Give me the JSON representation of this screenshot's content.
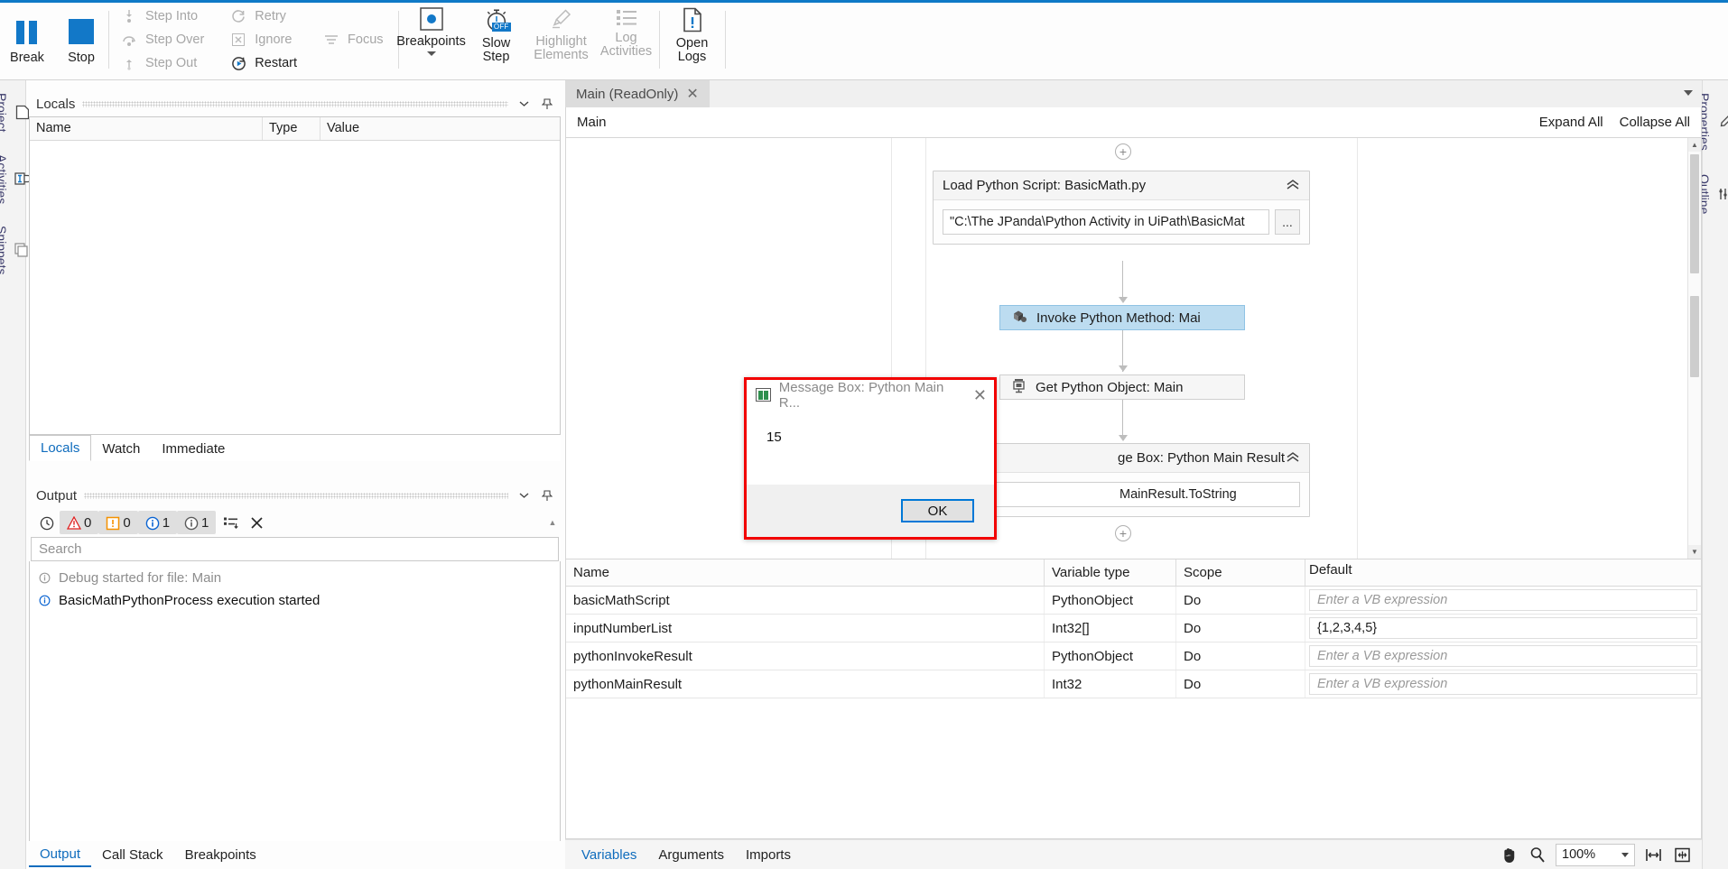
{
  "ribbon": {
    "break": {
      "label": "Break",
      "icon": "pause-icon"
    },
    "stop": {
      "label": "Stop",
      "icon": "stop-icon"
    },
    "step_into": {
      "label": "Step Into",
      "icon": "step-into-icon"
    },
    "step_over": {
      "label": "Step Over",
      "icon": "step-over-icon"
    },
    "step_out": {
      "label": "Step Out",
      "icon": "step-out-icon"
    },
    "retry": {
      "label": "Retry",
      "icon": "retry-icon"
    },
    "ignore": {
      "label": "Ignore",
      "icon": "ignore-icon"
    },
    "restart": {
      "label": "Restart",
      "icon": "restart-icon"
    },
    "focus": {
      "label": "Focus",
      "icon": "focus-icon"
    },
    "breakpoints": {
      "label": "Breakpoints",
      "icon": "breakpoint-dot-icon"
    },
    "slow_step": {
      "label_line1": "Slow",
      "label_line2": "Step",
      "icon": "stopwatch-off-icon",
      "badge": "OFF"
    },
    "highlight_elements": {
      "label_line1": "Highlight",
      "label_line2": "Elements",
      "icon": "highlighter-icon"
    },
    "log_activities": {
      "label_line1": "Log",
      "label_line2": "Activities",
      "icon": "list-icon"
    },
    "open_logs": {
      "label_line1": "Open",
      "label_line2": "Logs",
      "icon": "document-alert-icon"
    }
  },
  "left_rail": {
    "items": [
      {
        "label": "Project",
        "icon": "project-icon"
      },
      {
        "label": "Activities",
        "icon": "activities-icon"
      },
      {
        "label": "Snippets",
        "icon": "snippets-icon"
      }
    ]
  },
  "right_rail": {
    "items": [
      {
        "label": "Properties",
        "icon": "properties-icon"
      },
      {
        "label": "Outline",
        "icon": "outline-icon"
      }
    ]
  },
  "locals_panel": {
    "title": "Locals",
    "collapse_icon": "chevron-down-icon",
    "pin_icon": "pin-icon",
    "columns": [
      "Name",
      "Type",
      "Value"
    ],
    "rows": [],
    "tabs": [
      {
        "label": "Locals",
        "active": true
      },
      {
        "label": "Watch",
        "active": false
      },
      {
        "label": "Immediate",
        "active": false
      }
    ]
  },
  "output_panel": {
    "title": "Output",
    "collapse_icon": "chevron-down-icon",
    "pin_icon": "pin-icon",
    "toolbar": [
      {
        "name": "show-timestamps",
        "icon": "clock-icon",
        "count": ""
      },
      {
        "name": "errors-filter",
        "icon": "error-triangle-icon",
        "count": "0"
      },
      {
        "name": "warnings-filter",
        "icon": "warning-square-icon",
        "count": "0"
      },
      {
        "name": "info-filter",
        "icon": "info-circle-icon",
        "count": "1"
      },
      {
        "name": "trace-filter",
        "icon": "trace-circle-icon",
        "count": "1"
      },
      {
        "name": "export-logs",
        "icon": "export-list-icon",
        "count": ""
      },
      {
        "name": "clear-output",
        "icon": "close-x-icon",
        "count": ""
      }
    ],
    "search_placeholder": "Search",
    "messages": [
      {
        "icon": "info-circle-icon",
        "text": "Debug started for file: Main",
        "muted": true
      },
      {
        "icon": "info-circle-icon",
        "text": "BasicMathPythonProcess execution started",
        "muted": false
      }
    ],
    "tabs": [
      {
        "label": "Output",
        "active": true
      },
      {
        "label": "Call Stack",
        "active": false
      },
      {
        "label": "Breakpoints",
        "active": false
      }
    ]
  },
  "designer": {
    "document_tab": {
      "label": "Main (ReadOnly)",
      "close_icon": "close-icon"
    },
    "tabbar_overflow_icon": "chevron-down-icon",
    "breadcrumb": "Main",
    "expand_all": "Expand All",
    "collapse_all": "Collapse All",
    "nodes": {
      "top_plus": "+",
      "load_script": {
        "title": "Load Python Script: BasicMath.py",
        "collapse_icon": "chevron-up-icon",
        "path_value": "\"C:\\The JPanda\\Python Activity in UiPath\\BasicMat",
        "browse_label": "..."
      },
      "invoke_method": {
        "title": "Invoke Python Method: Mai",
        "icon": "invoke-python-icon",
        "selected": true
      },
      "get_object": {
        "title": "Get Python Object: Main",
        "icon": "get-python-object-icon"
      },
      "message_box_activity": {
        "title": "ge Box: Python Main Result",
        "full_title": "Message Box: Python Main Result",
        "collapse_icon": "chevron-up-icon",
        "expression": "MainResult.ToString"
      },
      "bottom_plus": "+",
      "lower_plus": "+"
    },
    "variables": {
      "columns": [
        "Name",
        "Variable type",
        "Scope",
        "Default"
      ],
      "default_placeholder": "Enter a VB expression",
      "rows": [
        {
          "name": "basicMathScript",
          "type": "PythonObject",
          "scope": "Do",
          "default": "",
          "default_is_placeholder": true
        },
        {
          "name": "inputNumberList",
          "type": "Int32[]",
          "scope": "Do",
          "default": "{1,2,3,4,5}",
          "default_is_placeholder": false
        },
        {
          "name": "pythonInvokeResult",
          "type": "PythonObject",
          "scope": "Do",
          "default": "",
          "default_is_placeholder": true
        },
        {
          "name": "pythonMainResult",
          "type": "Int32",
          "scope": "Do",
          "default": "",
          "default_is_placeholder": true
        }
      ]
    },
    "status_tabs": [
      {
        "label": "Variables",
        "active": true
      },
      {
        "label": "Arguments",
        "active": false
      },
      {
        "label": "Imports",
        "active": false
      }
    ],
    "status_right": {
      "pan_icon": "hand-pan-icon",
      "zoom_icon": "magnifier-icon",
      "zoom_value": "100%",
      "zoom_caret_icon": "chevron-down-icon",
      "fit_width_icon": "fit-to-width-icon",
      "fit_screen_icon": "fit-to-screen-icon"
    }
  },
  "message_box": {
    "title": "Message Box: Python Main R...",
    "app_icon": "messagebox-app-icon",
    "close_icon": "close-icon",
    "body_text": "15",
    "ok_label": "OK",
    "highlight_color": "#f20000",
    "focus_color": "#0078d7"
  }
}
